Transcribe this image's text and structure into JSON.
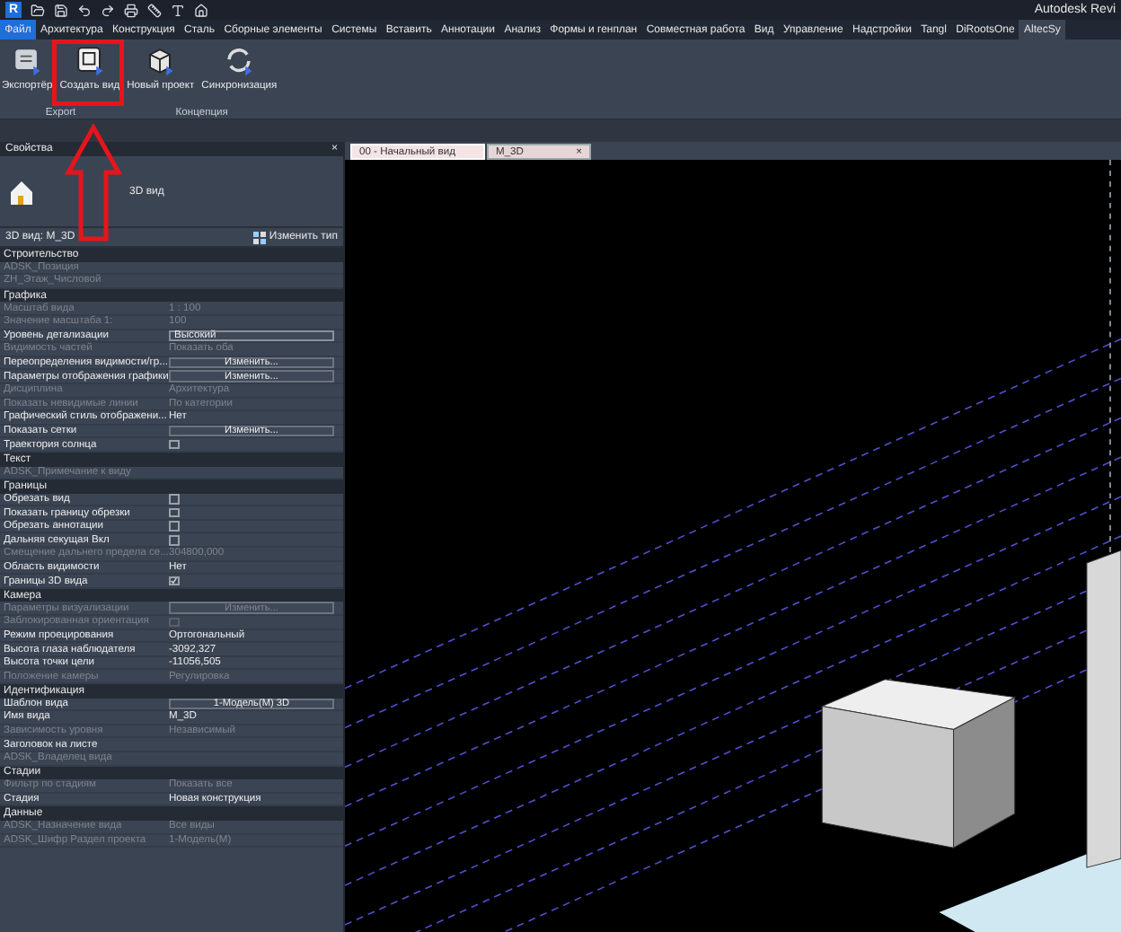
{
  "window": {
    "title": "Autodesk Revi",
    "logo": "R"
  },
  "ribbon_tabs": [
    {
      "label": "Файл",
      "kind": "application",
      "selected": false
    },
    {
      "label": "Архитектура",
      "kind": "tab",
      "selected": false
    },
    {
      "label": "Конструкция",
      "kind": "tab",
      "selected": false
    },
    {
      "label": "Сталь",
      "kind": "tab",
      "selected": false
    },
    {
      "label": "Сборные элементы",
      "kind": "tab",
      "selected": false
    },
    {
      "label": "Системы",
      "kind": "tab",
      "selected": false
    },
    {
      "label": "Вставить",
      "kind": "tab",
      "selected": false
    },
    {
      "label": "Аннотации",
      "kind": "tab",
      "selected": false
    },
    {
      "label": "Анализ",
      "kind": "tab",
      "selected": false
    },
    {
      "label": "Формы и генплан",
      "kind": "tab",
      "selected": false
    },
    {
      "label": "Совместная работа",
      "kind": "tab",
      "selected": false
    },
    {
      "label": "Вид",
      "kind": "tab",
      "selected": false
    },
    {
      "label": "Управление",
      "kind": "tab",
      "selected": false
    },
    {
      "label": "Надстройки",
      "kind": "tab",
      "selected": false
    },
    {
      "label": "Tangl",
      "kind": "tab",
      "selected": false
    },
    {
      "label": "DiRootsOne",
      "kind": "tab",
      "selected": false
    },
    {
      "label": "AltecSy",
      "kind": "tab",
      "selected": true
    }
  ],
  "ribbon_panels": [
    {
      "label": "Export",
      "buttons": [
        {
          "label": "Экспортёр",
          "kind": "export"
        },
        {
          "label": "Создать вид",
          "kind": "view"
        }
      ]
    },
    {
      "label": "Концепция",
      "buttons": [
        {
          "label": "Новый проект",
          "kind": "cube"
        },
        {
          "label": "Синхронизация",
          "kind": "sync"
        }
      ]
    }
  ],
  "annotations": {
    "highlight_rectangle": true,
    "arrow": true
  },
  "properties": {
    "title": "Свойства",
    "close": "×",
    "type_name": "3D вид",
    "instance": "3D вид: M_3D",
    "edit_type": "Изменить тип",
    "sections": [
      {
        "title": "Строительство",
        "rows": [
          {
            "label": "ADSK_Позиция",
            "kind": "text",
            "disabled": true
          },
          {
            "label": "ZH_Этаж_Числовой",
            "kind": "text",
            "disabled": true
          }
        ]
      },
      {
        "title": "Графика",
        "rows": [
          {
            "label": "Масштаб вида",
            "value": "1 : 100",
            "kind": "text",
            "disabled": true
          },
          {
            "label": "Значение масштаба    1:",
            "value": "100",
            "kind": "text",
            "disabled": true
          },
          {
            "label": "Уровень детализации",
            "value": "Высокий",
            "kind": "field",
            "disabled": false
          },
          {
            "label": "Видимость частей",
            "value": "Показать оба",
            "kind": "text",
            "disabled": true
          },
          {
            "label": "Переопределения видимости/гр...",
            "value": "Изменить...",
            "kind": "button",
            "disabled": false
          },
          {
            "label": "Параметры отображения графики",
            "value": "Изменить...",
            "kind": "button",
            "disabled": false
          },
          {
            "label": "Дисциплина",
            "value": "Архитектура",
            "kind": "text",
            "disabled": true
          },
          {
            "label": "Показать невидимые линии",
            "value": "По категории",
            "kind": "text",
            "disabled": true
          },
          {
            "label": "Графический стиль отображени...",
            "value": "Нет",
            "kind": "text",
            "disabled": false
          },
          {
            "label": "Показать сетки",
            "value": "Изменить...",
            "kind": "button",
            "disabled": false
          },
          {
            "label": "Траектория солнца",
            "kind": "checkbox",
            "checked": false,
            "disabled": false
          }
        ]
      },
      {
        "title": "Текст",
        "rows": [
          {
            "label": "ADSK_Примечание к виду",
            "kind": "text",
            "disabled": true
          }
        ]
      },
      {
        "title": "Границы",
        "rows": [
          {
            "label": "Обрезать вид",
            "kind": "checkbox",
            "checked": false,
            "disabled": false
          },
          {
            "label": "Показать границу обрезки",
            "kind": "checkbox",
            "checked": false,
            "disabled": false
          },
          {
            "label": "Обрезать аннотации",
            "kind": "checkbox",
            "checked": false,
            "disabled": false
          },
          {
            "label": "Дальняя секущая Вкл",
            "kind": "checkbox",
            "checked": false,
            "disabled": false
          },
          {
            "label": "Смещение дальнего предела се...",
            "value": "304800,000",
            "kind": "text",
            "disabled": true
          },
          {
            "label": "Область видимости",
            "value": "Нет",
            "kind": "text",
            "disabled": false
          },
          {
            "label": "Границы 3D вида",
            "kind": "checkbox",
            "checked": true,
            "disabled": false
          }
        ]
      },
      {
        "title": "Камера",
        "rows": [
          {
            "label": "Параметры визуализации",
            "value": "Изменить...",
            "kind": "button",
            "disabled": true
          },
          {
            "label": "Заблокированная ориентация",
            "kind": "checkbox",
            "checked": false,
            "disabled": true
          },
          {
            "label": "Режим проецирования",
            "value": "Ортогональный",
            "kind": "text",
            "disabled": false
          },
          {
            "label": "Высота глаза наблюдателя",
            "value": "-3092,327",
            "kind": "text",
            "disabled": false
          },
          {
            "label": "Высота точки цели",
            "value": "-11056,505",
            "kind": "text",
            "disabled": false
          },
          {
            "label": "Положение камеры",
            "value": "Регулировка",
            "kind": "text",
            "disabled": true
          }
        ]
      },
      {
        "title": "Идентификация",
        "rows": [
          {
            "label": "Шаблон вида",
            "value": "1-Модель(M) 3D",
            "kind": "button",
            "disabled": false
          },
          {
            "label": "Имя вида",
            "value": "M_3D",
            "kind": "text",
            "disabled": false
          },
          {
            "label": "Зависимость уровня",
            "value": "Независимый",
            "kind": "text",
            "disabled": true
          },
          {
            "label": "Заголовок на листе",
            "kind": "text",
            "disabled": false
          },
          {
            "label": "ADSK_Владелец вида",
            "kind": "text",
            "disabled": true
          }
        ]
      },
      {
        "title": "Стадии",
        "rows": [
          {
            "label": "Фильтр по стадиям",
            "value": "Показать все",
            "kind": "text",
            "disabled": true
          },
          {
            "label": "Стадия",
            "value": "Новая конструкция",
            "kind": "text",
            "disabled": false
          }
        ]
      },
      {
        "title": "Данные",
        "rows": [
          {
            "label": "ADSK_Назначение вида",
            "value": "Все виды",
            "kind": "text",
            "disabled": true
          },
          {
            "label": "ADSK_Шифр Раздел проекта",
            "value": "1-Модель(M)",
            "kind": "text",
            "disabled": true
          }
        ]
      }
    ]
  },
  "view_tabs": [
    {
      "label": "00 - Начальный вид",
      "selected": true,
      "closable": false
    },
    {
      "label": "M_3D",
      "selected": false,
      "closable": true,
      "close": "×"
    }
  ]
}
